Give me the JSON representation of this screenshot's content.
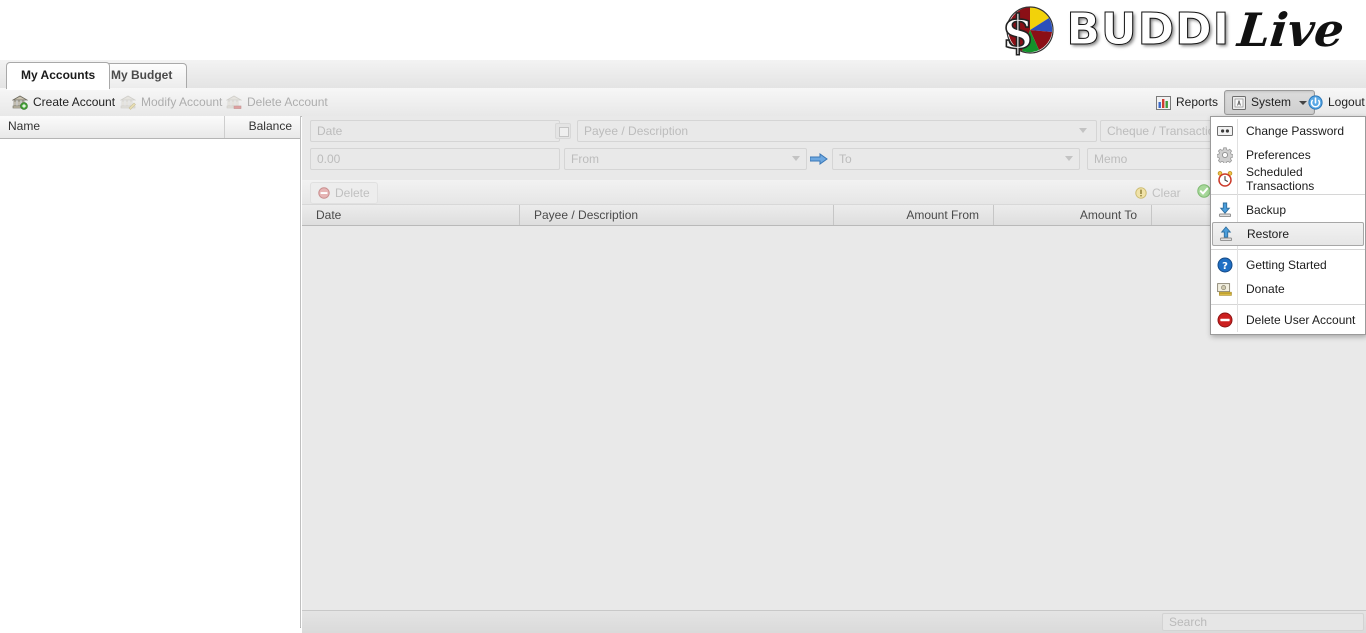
{
  "header": {
    "logo_brand": "BUDDI",
    "logo_suffix": "Live",
    "logo_icon": "pie-chart-dollar-logo"
  },
  "tabs": [
    {
      "label": "My Accounts",
      "active": true
    },
    {
      "label": "My Budget",
      "active": false
    }
  ],
  "toolbar": {
    "left_buttons": [
      {
        "label": "Create Account",
        "icon": "bank-add-icon",
        "enabled": true
      },
      {
        "label": "Modify Account",
        "icon": "bank-edit-icon",
        "enabled": false
      },
      {
        "label": "Delete Account",
        "icon": "bank-delete-icon",
        "enabled": false
      }
    ],
    "right_buttons": [
      {
        "label": "Reports",
        "icon": "bar-chart-icon",
        "has_caret": true,
        "pressed": false
      },
      {
        "label": "System",
        "icon": "system-icon",
        "has_caret": true,
        "pressed": true
      },
      {
        "label": "Logout",
        "icon": "power-icon",
        "has_caret": false,
        "pressed": false
      }
    ]
  },
  "accounts_panel": {
    "columns": [
      "Name",
      "Balance"
    ],
    "rows": []
  },
  "transaction_entry": {
    "date_placeholder": "Date",
    "payee_placeholder": "Payee / Description",
    "cheque_placeholder": "Cheque / Transaction",
    "amount_placeholder": "0.00",
    "from_placeholder": "From",
    "to_placeholder": "To",
    "memo_placeholder": "Memo",
    "calendar_icon": "calendar-icon",
    "transfer_icon": "arrow-right-icon"
  },
  "transaction_actions": {
    "delete_label": "Delete",
    "delete_icon": "delete-circle-icon",
    "clear_label": "Clear",
    "clear_icon": "warning-icon",
    "ok_icon": "check-circle-icon"
  },
  "transaction_table": {
    "columns": [
      "Date",
      "Payee / Description",
      "Amount From",
      "Amount To"
    ],
    "rows": []
  },
  "footer": {
    "search_placeholder": "Search"
  },
  "system_menu": {
    "open": true,
    "items": [
      {
        "label": "Change Password",
        "icon": "password-icon",
        "highlighted": false,
        "separator_after": false
      },
      {
        "label": "Preferences",
        "icon": "gear-icon",
        "highlighted": false,
        "separator_after": false
      },
      {
        "label": "Scheduled Transactions",
        "icon": "alarm-clock-icon",
        "highlighted": false,
        "separator_after": true
      },
      {
        "label": "Backup",
        "icon": "download-icon",
        "highlighted": false,
        "separator_after": false
      },
      {
        "label": "Restore",
        "icon": "upload-icon",
        "highlighted": true,
        "separator_after": true
      },
      {
        "label": "Getting Started",
        "icon": "help-icon",
        "highlighted": false,
        "separator_after": false
      },
      {
        "label": "Donate",
        "icon": "money-icon",
        "highlighted": false,
        "separator_after": true
      },
      {
        "label": "Delete User Account",
        "icon": "no-entry-icon",
        "highlighted": false,
        "separator_after": false
      }
    ]
  },
  "colors": {
    "accent_blue": "#3c78c8",
    "brand_red": "#8b0f16",
    "brand_yellow": "#f2d20a",
    "brand_blue": "#2a4fbb",
    "brand_green": "#12922a",
    "highlight_border": "#a7a7a7"
  }
}
